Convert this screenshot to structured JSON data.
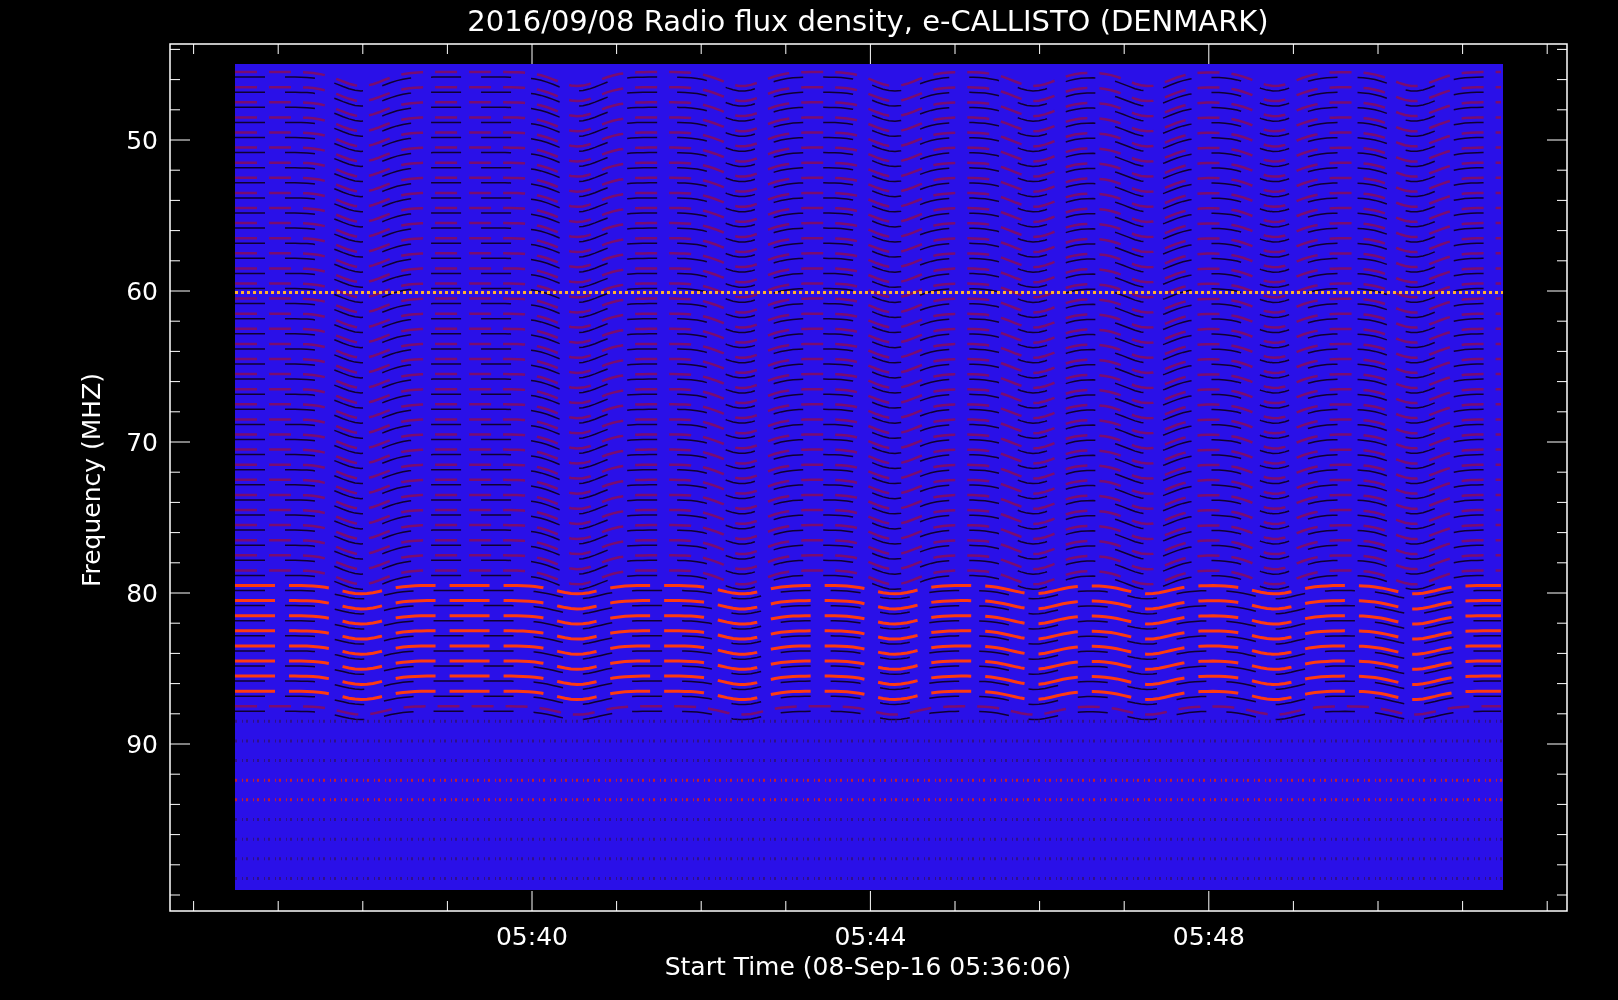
{
  "plot": {
    "title": "2016/09/08  Radio flux density, e-CALLISTO (DENMARK)",
    "ylabel": "Frequency (MHZ)",
    "xlabel": "Start Time (08-Sep-16 05:36:06)",
    "yticks": [
      "50",
      "60",
      "70",
      "80",
      "90"
    ],
    "xticks": [
      "05:40",
      "05:44",
      "05:48"
    ]
  }
}
